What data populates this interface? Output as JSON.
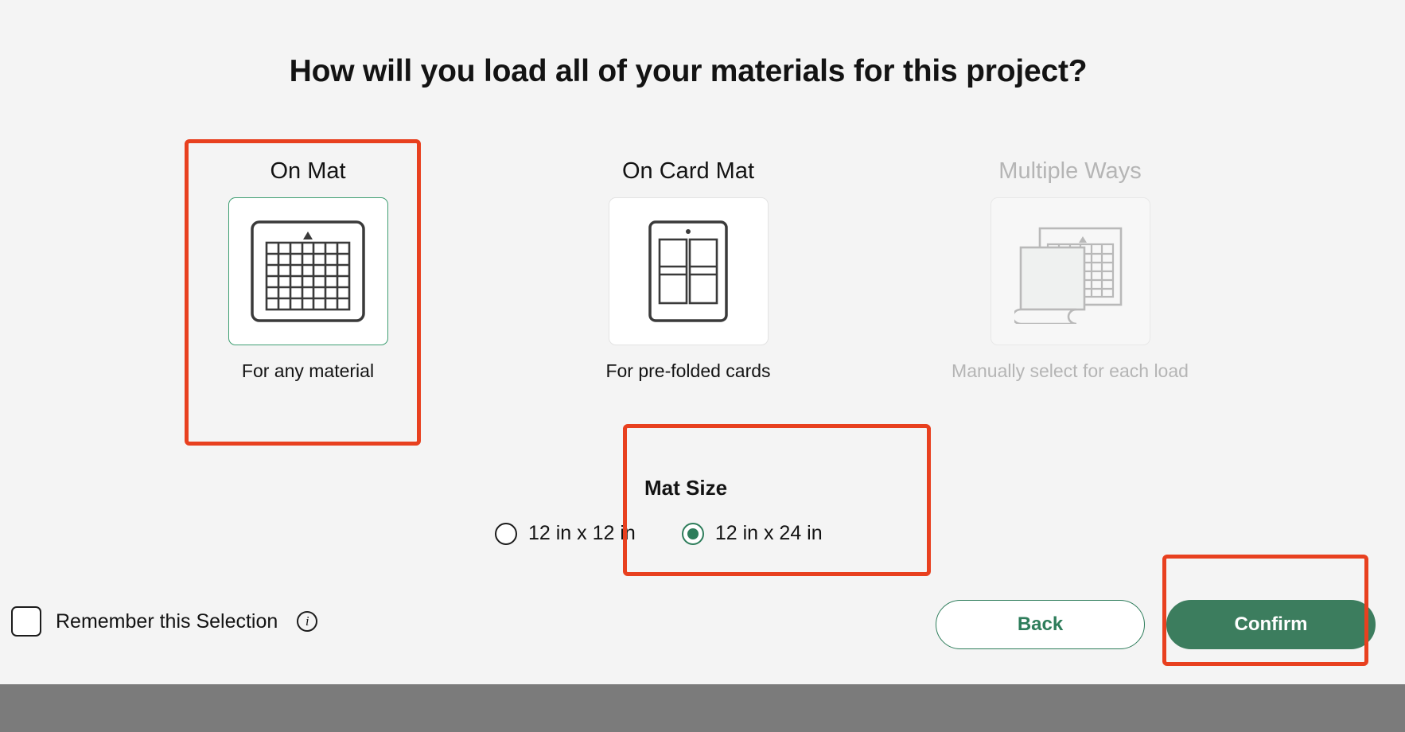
{
  "dialog": {
    "title": "How will you load all of your materials for this project?"
  },
  "options": [
    {
      "id": "on-mat",
      "title": "On Mat",
      "caption": "For any material",
      "icon": "cutting-mat-grid-icon",
      "selected": true,
      "disabled": false
    },
    {
      "id": "on-card-mat",
      "title": "On Card Mat",
      "caption": "For pre-folded cards",
      "icon": "card-mat-icon",
      "selected": false,
      "disabled": false
    },
    {
      "id": "multiple-ways",
      "title": "Multiple Ways",
      "caption": "Manually select for each load",
      "icon": "multiple-materials-icon",
      "selected": false,
      "disabled": true
    }
  ],
  "mat_size": {
    "label": "Mat Size",
    "options": [
      {
        "id": "12x12",
        "label": "12 in x 12 in",
        "checked": false
      },
      {
        "id": "12x24",
        "label": "12 in x 24 in",
        "checked": true
      }
    ]
  },
  "footer": {
    "remember_label": "Remember this Selection",
    "info_icon": "info-icon",
    "info_glyph": "i",
    "remember_checked": false,
    "back_label": "Back",
    "confirm_label": "Confirm"
  },
  "colors": {
    "background": "#f4f4f4",
    "bottom_bar": "#7b7b7b",
    "accent_green": "#3c7d5e",
    "selected_border_green": "#3f9e72",
    "annotation_red": "#e8401f",
    "text": "#131313",
    "disabled_text": "#b5b5b5"
  }
}
